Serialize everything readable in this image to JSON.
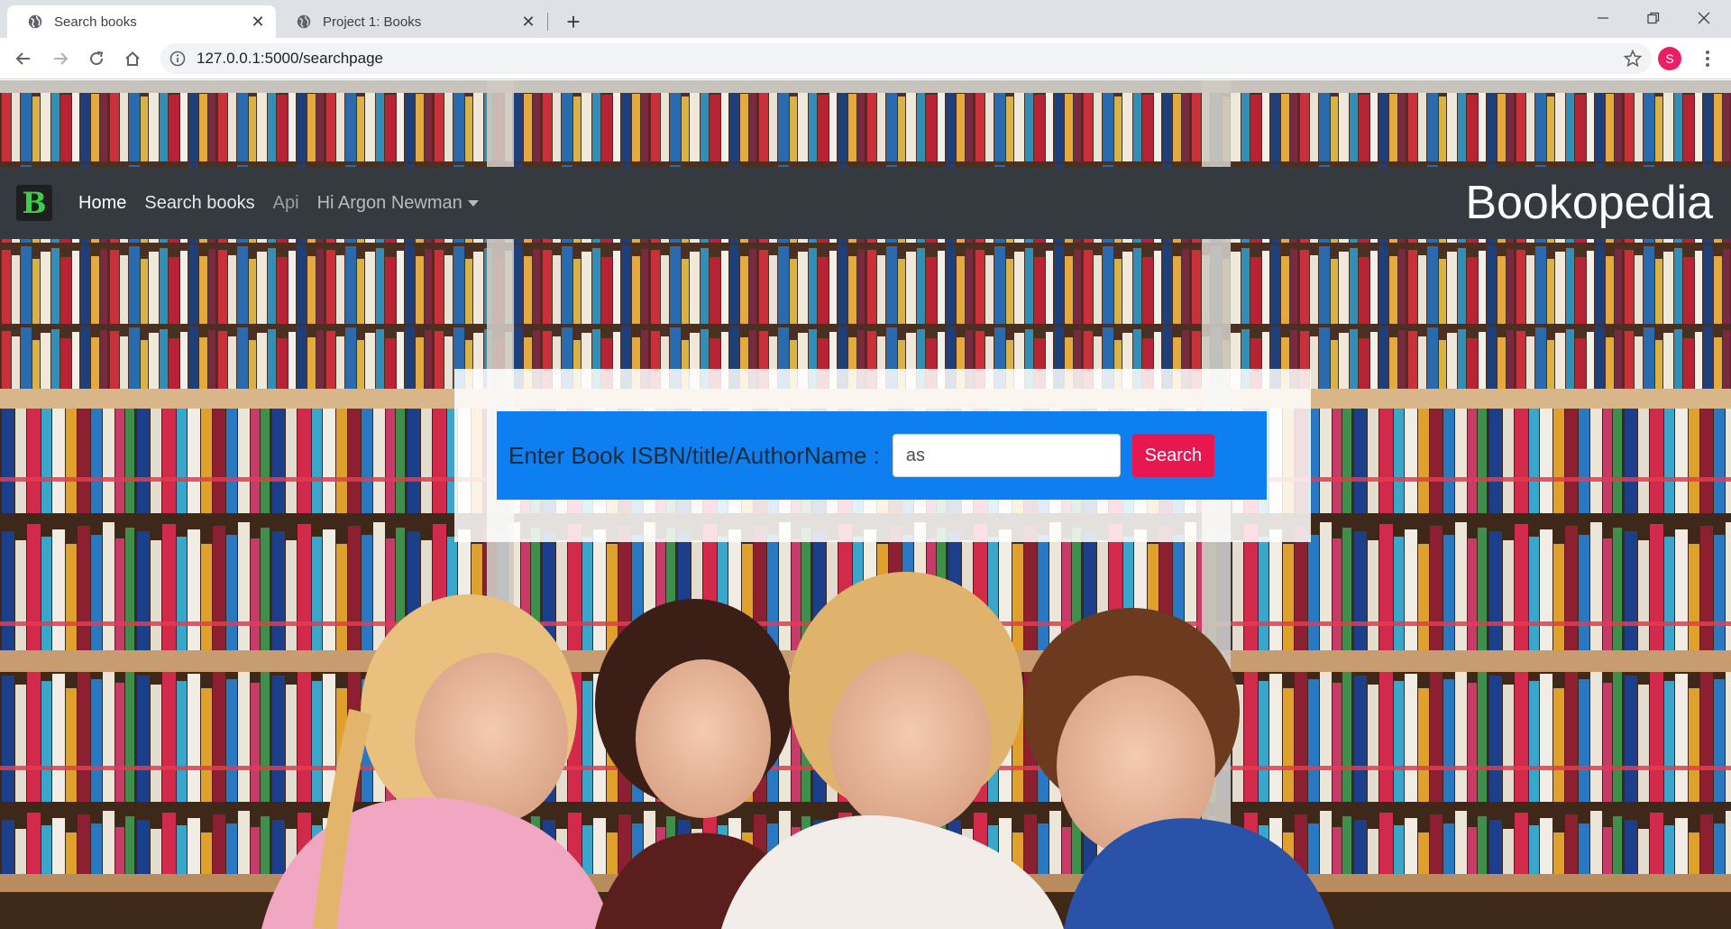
{
  "browser": {
    "tabs": [
      {
        "title": "Search books",
        "active": true
      },
      {
        "title": "Project 1: Books",
        "active": false
      }
    ],
    "url": "127.0.0.1:5000/searchpage",
    "profile_initial": "S"
  },
  "navbar": {
    "brand_letter": "B",
    "links": {
      "home": "Home",
      "search": "Search books",
      "api": "Api",
      "user": "Hi Argon Newman"
    },
    "site_title": "Bookopedia"
  },
  "search": {
    "label": "Enter Book ISBN/title/AuthorName :",
    "input_value": "as",
    "button_label": "Search"
  },
  "colors": {
    "navbar": "#343a40",
    "search_bar": "#0d7ff0",
    "search_button": "#e8174f",
    "brand_letter": "#3ecf4a"
  }
}
